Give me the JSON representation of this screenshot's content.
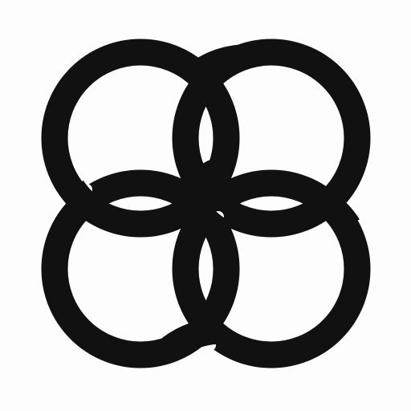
{
  "logo": {
    "name": "four-ring-knot-icon",
    "ink_color": "#111111",
    "background_color": "#fdfdfd"
  }
}
